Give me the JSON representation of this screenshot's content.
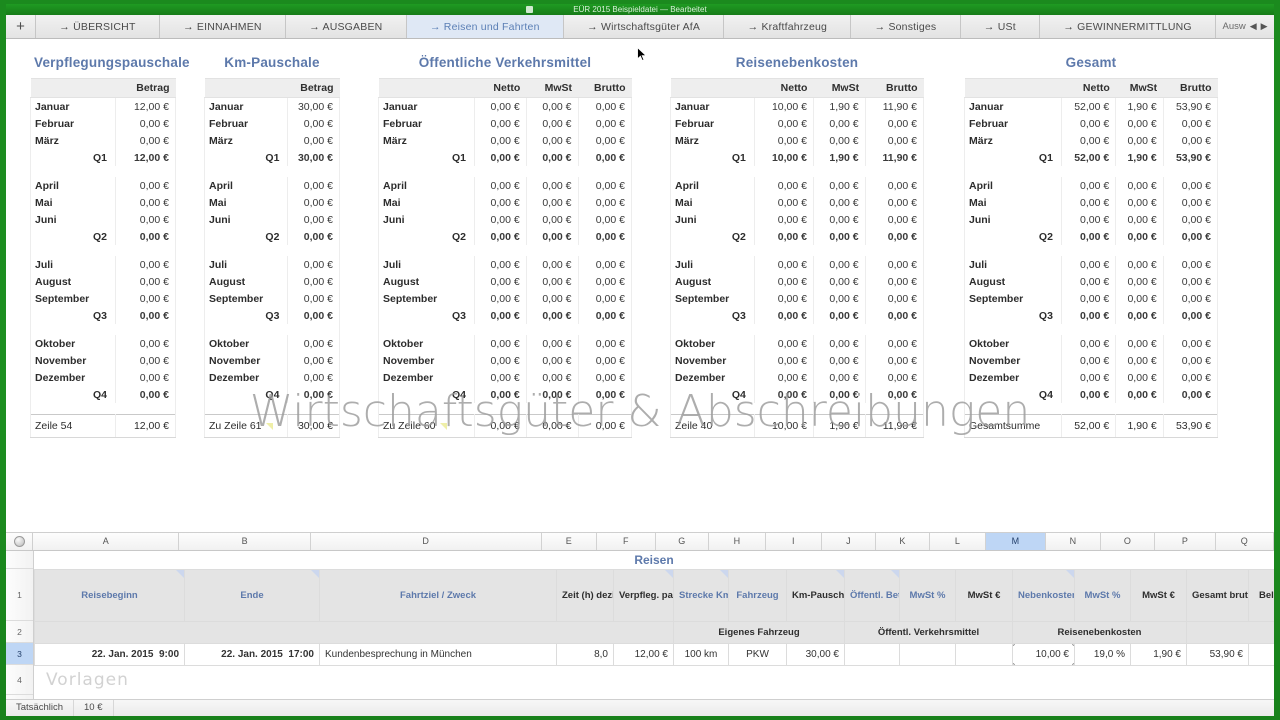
{
  "window": {
    "title": "EÜR 2015 Beispieldatei — Bearbeitet"
  },
  "tabbar": {
    "add_label": "+",
    "scroll_label": "Ausw",
    "scroll_prev": "◀",
    "scroll_next": "▶",
    "tabs": [
      {
        "label": "→ ÜBERSICHT",
        "active": false
      },
      {
        "label": "→ EINNAHMEN",
        "active": false
      },
      {
        "label": "→ AUSGABEN",
        "active": false
      },
      {
        "label": "→ Reisen und Fahrten",
        "active": true
      },
      {
        "label": "→ Wirtschaftsgüter AfA",
        "active": false
      },
      {
        "label": "→ Kraftfahrzeug",
        "active": false
      },
      {
        "label": "→ Sonstiges",
        "active": false
      },
      {
        "label": "→ USt",
        "active": false
      },
      {
        "label": "→ GEWINNERMITTLUNG",
        "active": false
      }
    ]
  },
  "watermark": "Wirtschaftsgüter & Abschreibungen",
  "vorlagen_watermark": "Vorlagen",
  "report": {
    "months": [
      "Januar",
      "Februar",
      "März",
      "April",
      "Mai",
      "Juni",
      "Juli",
      "August",
      "September",
      "Oktober",
      "November",
      "Dezember"
    ],
    "quarters": [
      "Q1",
      "Q2",
      "Q3",
      "Q4"
    ],
    "blocks": [
      {
        "title": "Verpflegungspauschale",
        "columns": [
          "Betrag"
        ],
        "rows": [
          [
            "12,00 €"
          ],
          [
            "0,00 €"
          ],
          [
            "0,00 €"
          ],
          [
            "0,00 €"
          ],
          [
            "0,00 €"
          ],
          [
            "0,00 €"
          ],
          [
            "0,00 €"
          ],
          [
            "0,00 €"
          ],
          [
            "0,00 €"
          ],
          [
            "0,00 €"
          ],
          [
            "0,00 €"
          ],
          [
            "0,00 €"
          ]
        ],
        "quarter_totals": [
          [
            "12,00 €"
          ],
          [
            "0,00 €"
          ],
          [
            "0,00 €"
          ],
          [
            "0,00 €"
          ]
        ],
        "footer_label": "Zeile 54",
        "footer_values": [
          "12,00 €"
        ],
        "footer_note": false
      },
      {
        "title": "Km-Pauschale",
        "columns": [
          "Betrag"
        ],
        "rows": [
          [
            "30,00 €"
          ],
          [
            "0,00 €"
          ],
          [
            "0,00 €"
          ],
          [
            "0,00 €"
          ],
          [
            "0,00 €"
          ],
          [
            "0,00 €"
          ],
          [
            "0,00 €"
          ],
          [
            "0,00 €"
          ],
          [
            "0,00 €"
          ],
          [
            "0,00 €"
          ],
          [
            "0,00 €"
          ],
          [
            "0,00 €"
          ]
        ],
        "quarter_totals": [
          [
            "30,00 €"
          ],
          [
            "0,00 €"
          ],
          [
            "0,00 €"
          ],
          [
            "0,00 €"
          ]
        ],
        "footer_label": "Zu Zeile 61",
        "footer_values": [
          "30,00 €"
        ],
        "footer_note": true
      },
      {
        "title": "Öffentliche Verkehrsmittel",
        "columns": [
          "Netto",
          "MwSt",
          "Brutto"
        ],
        "rows": [
          [
            "0,00 €",
            "0,00 €",
            "0,00 €"
          ],
          [
            "0,00 €",
            "0,00 €",
            "0,00 €"
          ],
          [
            "0,00 €",
            "0,00 €",
            "0,00 €"
          ],
          [
            "0,00 €",
            "0,00 €",
            "0,00 €"
          ],
          [
            "0,00 €",
            "0,00 €",
            "0,00 €"
          ],
          [
            "0,00 €",
            "0,00 €",
            "0,00 €"
          ],
          [
            "0,00 €",
            "0,00 €",
            "0,00 €"
          ],
          [
            "0,00 €",
            "0,00 €",
            "0,00 €"
          ],
          [
            "0,00 €",
            "0,00 €",
            "0,00 €"
          ],
          [
            "0,00 €",
            "0,00 €",
            "0,00 €"
          ],
          [
            "0,00 €",
            "0,00 €",
            "0,00 €"
          ],
          [
            "0,00 €",
            "0,00 €",
            "0,00 €"
          ]
        ],
        "quarter_totals": [
          [
            "0,00 €",
            "0,00 €",
            "0,00 €"
          ],
          [
            "0,00 €",
            "0,00 €",
            "0,00 €"
          ],
          [
            "0,00 €",
            "0,00 €",
            "0,00 €"
          ],
          [
            "0,00 €",
            "0,00 €",
            "0,00 €"
          ]
        ],
        "footer_label": "Zu Zeile 60",
        "footer_values": [
          "0,00 €",
          "0,00 €",
          "0,00 €"
        ],
        "footer_note": true
      },
      {
        "title": "Reisenebenkosten",
        "columns": [
          "Netto",
          "MwSt",
          "Brutto"
        ],
        "rows": [
          [
            "10,00 €",
            "1,90 €",
            "11,90 €"
          ],
          [
            "0,00 €",
            "0,00 €",
            "0,00 €"
          ],
          [
            "0,00 €",
            "0,00 €",
            "0,00 €"
          ],
          [
            "0,00 €",
            "0,00 €",
            "0,00 €"
          ],
          [
            "0,00 €",
            "0,00 €",
            "0,00 €"
          ],
          [
            "0,00 €",
            "0,00 €",
            "0,00 €"
          ],
          [
            "0,00 €",
            "0,00 €",
            "0,00 €"
          ],
          [
            "0,00 €",
            "0,00 €",
            "0,00 €"
          ],
          [
            "0,00 €",
            "0,00 €",
            "0,00 €"
          ],
          [
            "0,00 €",
            "0,00 €",
            "0,00 €"
          ],
          [
            "0,00 €",
            "0,00 €",
            "0,00 €"
          ],
          [
            "0,00 €",
            "0,00 €",
            "0,00 €"
          ]
        ],
        "quarter_totals": [
          [
            "10,00 €",
            "1,90 €",
            "11,90 €"
          ],
          [
            "0,00 €",
            "0,00 €",
            "0,00 €"
          ],
          [
            "0,00 €",
            "0,00 €",
            "0,00 €"
          ],
          [
            "0,00 €",
            "0,00 €",
            "0,00 €"
          ]
        ],
        "footer_label": "Zeile 40",
        "footer_values": [
          "10,00 €",
          "1,90 €",
          "11,90 €"
        ],
        "footer_note": false
      },
      {
        "title": "Gesamt",
        "columns": [
          "Netto",
          "MwSt",
          "Brutto"
        ],
        "rows": [
          [
            "52,00 €",
            "1,90 €",
            "53,90 €"
          ],
          [
            "0,00 €",
            "0,00 €",
            "0,00 €"
          ],
          [
            "0,00 €",
            "0,00 €",
            "0,00 €"
          ],
          [
            "0,00 €",
            "0,00 €",
            "0,00 €"
          ],
          [
            "0,00 €",
            "0,00 €",
            "0,00 €"
          ],
          [
            "0,00 €",
            "0,00 €",
            "0,00 €"
          ],
          [
            "0,00 €",
            "0,00 €",
            "0,00 €"
          ],
          [
            "0,00 €",
            "0,00 €",
            "0,00 €"
          ],
          [
            "0,00 €",
            "0,00 €",
            "0,00 €"
          ],
          [
            "0,00 €",
            "0,00 €",
            "0,00 €"
          ],
          [
            "0,00 €",
            "0,00 €",
            "0,00 €"
          ],
          [
            "0,00 €",
            "0,00 €",
            "0,00 €"
          ]
        ],
        "quarter_totals": [
          [
            "52,00 €",
            "1,90 €",
            "53,90 €"
          ],
          [
            "0,00 €",
            "0,00 €",
            "0,00 €"
          ],
          [
            "0,00 €",
            "0,00 €",
            "0,00 €"
          ],
          [
            "0,00 €",
            "0,00 €",
            "0,00 €"
          ]
        ],
        "footer_label": "Gesamtsumme",
        "footer_values": [
          "52,00 €",
          "1,90 €",
          "53,90 €"
        ],
        "footer_note": false
      }
    ]
  },
  "spreadsheet": {
    "title": "Reisen",
    "column_letters": [
      "A",
      "B",
      "D",
      "E",
      "F",
      "G",
      "H",
      "I",
      "J",
      "K",
      "L",
      "M",
      "N",
      "O",
      "P",
      "Q"
    ],
    "selected_column": "M",
    "row_numbers": [
      "1",
      "2",
      "3",
      "4"
    ],
    "selected_row": "3",
    "headers": [
      {
        "label": "Reisebeginn",
        "blue": true,
        "flag": true
      },
      {
        "label": "Ende",
        "blue": true,
        "flag": true
      },
      {
        "label": "Fahrtziel / Zweck",
        "blue": true,
        "flag": false
      },
      {
        "label": "Zeit (h) dezimal",
        "blue": false,
        "flag": false
      },
      {
        "label": "Verpfleg. pauschale",
        "blue": false,
        "flag": true
      },
      {
        "label": "Strecke Km",
        "blue": true,
        "flag": true
      },
      {
        "label": "Fahrzeug",
        "blue": true,
        "flag": false
      },
      {
        "label": "Km-Pauschale",
        "blue": false,
        "flag": true
      },
      {
        "label": "Öffentl. Betrag netto",
        "blue": true,
        "flag": true
      },
      {
        "label": "MwSt %",
        "blue": true,
        "flag": false
      },
      {
        "label": "MwSt €",
        "blue": false,
        "flag": false
      },
      {
        "label": "Nebenkosten netto",
        "blue": true,
        "flag": true
      },
      {
        "label": "MwSt %",
        "blue": true,
        "flag": false
      },
      {
        "label": "MwSt €",
        "blue": false,
        "flag": false
      },
      {
        "label": "Gesamt brutto",
        "blue": false,
        "flag": false
      },
      {
        "label": "Beleg Nr",
        "blue": false,
        "flag": false
      }
    ],
    "group_row": [
      {
        "label": "",
        "span": 5
      },
      {
        "label": "Eigenes Fahrzeug",
        "span": 3
      },
      {
        "label": "Öffentl. Verkehrsmittel",
        "span": 3
      },
      {
        "label": "Reisenebenkosten",
        "span": 3
      },
      {
        "label": "",
        "span": 2
      }
    ],
    "data_row": {
      "begin_date": "22. Jan. 2015",
      "begin_time": "9:00",
      "end_date": "22. Jan. 2015",
      "end_time": "17:00",
      "purpose": "Kundenbesprechung in München",
      "hours": "8,0",
      "verpflegung": "12,00 €",
      "strecke": "100 km",
      "fahrzeug": "PKW",
      "km_pauschale": "30,00 €",
      "oeff_netto": "",
      "oeff_mwst_pct": "",
      "oeff_mwst_eur": "",
      "neben_netto": "10,00 €",
      "neben_mwst_pct": "19,0 %",
      "neben_mwst_eur": "1,90 €",
      "gesamt_brutto": "53,90 €",
      "beleg_nr": ""
    }
  },
  "statusbar": {
    "label": "Tatsächlich",
    "value": "10 €"
  },
  "colors": {
    "accent_blue": "#5d79ab",
    "selection": "#bed6f5",
    "desktop_green": "#1c8a1f"
  }
}
